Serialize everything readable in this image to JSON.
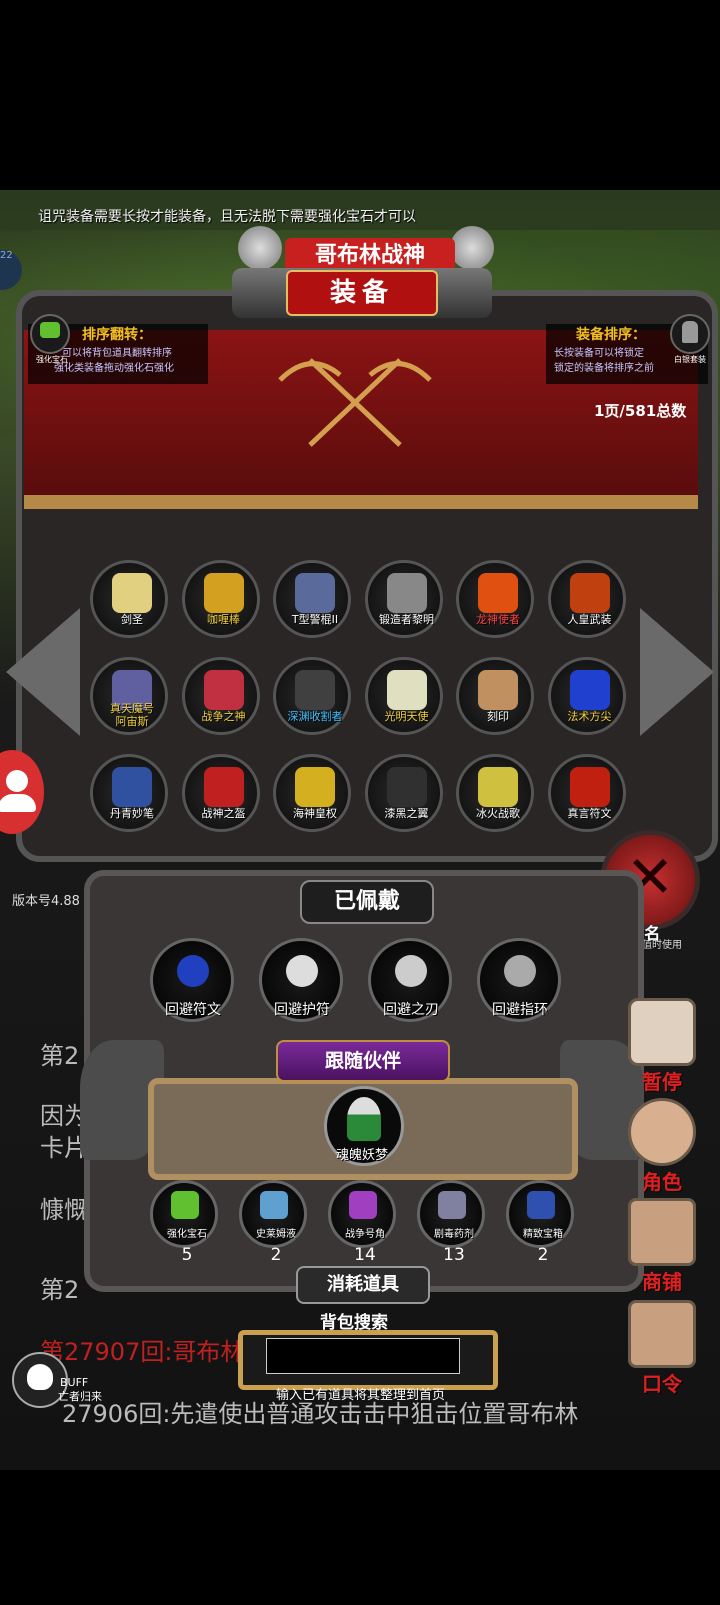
{
  "notice": "诅咒装备需要长按才能装备，且无法脱下需要强化宝石才可以",
  "game_title_partial": "哥布林战神",
  "tab_title": "装备",
  "left_corner": {
    "label": "强化宝石"
  },
  "right_corner": {
    "label": "白银套装"
  },
  "sort_flip": {
    "heading": "排序翻转：",
    "line1": "可以将背包道具翻转排序",
    "line2": "强化类装备拖动强化石强化"
  },
  "equip_sort": {
    "heading": "装备排序：",
    "line1": "长按装备可以将锁定",
    "line2": "锁定的装备将排序之前"
  },
  "page_count": "1页/581总数",
  "equipment_items": [
    {
      "label": "剑圣",
      "color": "#e0d080",
      "label_color": "#ffffff"
    },
    {
      "label": "咖喱棒",
      "color": "#d4a020",
      "label_color": "#f0d040"
    },
    {
      "label": "T型警棍II",
      "color": "#5a6a9a",
      "label_color": "#ffffff"
    },
    {
      "label": "锻造者黎明",
      "color": "#888888",
      "label_color": "#ffffff"
    },
    {
      "label": "龙神使者",
      "color": "#e05010",
      "label_color": "#ff4040"
    },
    {
      "label": "人皇武装",
      "color": "#c04010",
      "label_color": "#ffffff"
    },
    {
      "label": "真天魔号\n阿宙斯",
      "color": "#6060a0",
      "label_color": "#f0d040"
    },
    {
      "label": "战争之神",
      "color": "#c03040",
      "label_color": "#f0d040"
    },
    {
      "label": "深渊收割者",
      "color": "#404040",
      "label_color": "#40c0ff"
    },
    {
      "label": "光明天使",
      "color": "#e0e0c0",
      "label_color": "#f0d040"
    },
    {
      "label": "刻印",
      "color": "#c09060",
      "label_color": "#ffffff"
    },
    {
      "label": "法术方尖",
      "color": "#2040d0",
      "label_color": "#f0d040"
    },
    {
      "label": "丹青妙笔",
      "color": "#3050a0",
      "label_color": "#ffffff"
    },
    {
      "label": "战神之盔",
      "color": "#c02020",
      "label_color": "#ffffff"
    },
    {
      "label": "海神皇权",
      "color": "#d4b020",
      "label_color": "#ffffff"
    },
    {
      "label": "漆黑之翼",
      "color": "#303030",
      "label_color": "#ffffff"
    },
    {
      "label": "冰火战歌",
      "color": "#d0c040",
      "label_color": "#ffffff"
    },
    {
      "label": "真言符文",
      "color": "#c02010",
      "label_color": "#ffffff"
    }
  ],
  "version": "版本号4.88",
  "right_partial": {
    "big": "70名",
    "small": "其数值时使用"
  },
  "worn": {
    "heading": "已佩戴",
    "items": [
      {
        "label": "回避符文",
        "color": "#2040c0"
      },
      {
        "label": "回避护符",
        "color": "#dddddd"
      },
      {
        "label": "回避之刃",
        "color": "#cccccc"
      },
      {
        "label": "回避指环",
        "color": "#aaaaaa"
      }
    ]
  },
  "companion": {
    "heading": "跟随伙伴",
    "name": "魂魄妖梦"
  },
  "consumables": {
    "heading": "消耗道具",
    "items": [
      {
        "label": "强化宝石",
        "count": "5",
        "color": "#60c030"
      },
      {
        "label": "史莱姆液",
        "count": "2",
        "color": "#60a0d0"
      },
      {
        "label": "战争号角",
        "count": "14",
        "color": "#a040c0"
      },
      {
        "label": "剧毒药剂",
        "count": "13",
        "color": "#8080a0"
      },
      {
        "label": "精致宝箱",
        "count": "2",
        "color": "#3050b0"
      }
    ]
  },
  "search": {
    "label": "背包搜索",
    "hint": "输入已有道具将其整理到首页",
    "value": ""
  },
  "log_fragments": {
    "line1": "第2",
    "line2a": "因为",
    "line2b": "卡片",
    "line3": "慷慨",
    "line4": "第2",
    "line5": "第27907回:哥布林",
    "line6": "27906回:先遣使出普通攻击击中狙击位置哥布林"
  },
  "side_buttons": [
    {
      "label": "暂停"
    },
    {
      "label": "角色"
    },
    {
      "label": "商铺"
    },
    {
      "label": "口令"
    }
  ],
  "buff": {
    "top": "BUFF",
    "bottom": "亡者归来"
  },
  "edge_tag": "22"
}
